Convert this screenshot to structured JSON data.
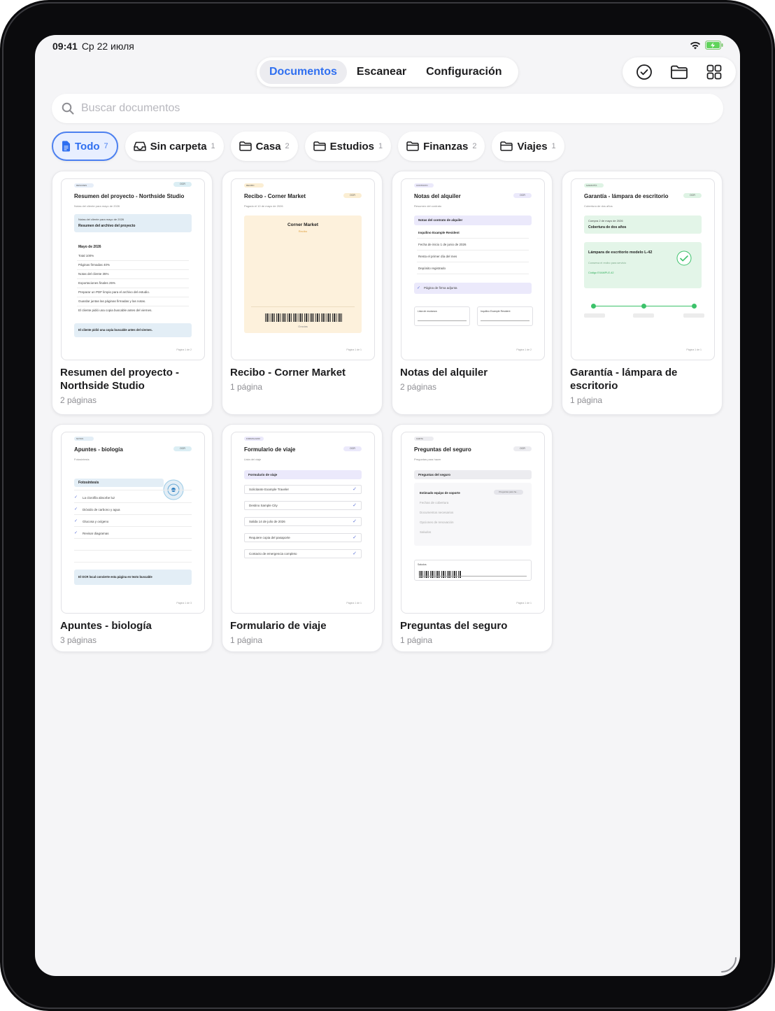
{
  "status_bar": {
    "time": "09:41",
    "date": "Ср 22 июля"
  },
  "tabs": [
    {
      "label": "Documentos",
      "active": true
    },
    {
      "label": "Escanear",
      "active": false
    },
    {
      "label": "Configuración",
      "active": false
    }
  ],
  "toolbar_icons": [
    "checkmark-circle-icon",
    "folder-icon",
    "grid-icon"
  ],
  "search": {
    "placeholder": "Buscar documentos",
    "value": ""
  },
  "filters": [
    {
      "label": "Todo",
      "count": "7",
      "icon": "document-icon",
      "active": true
    },
    {
      "label": "Sin carpeta",
      "count": "1",
      "icon": "tray-icon"
    },
    {
      "label": "Casa",
      "count": "2",
      "icon": "folder-icon"
    },
    {
      "label": "Estudios",
      "count": "1",
      "icon": "folder-icon"
    },
    {
      "label": "Finanzas",
      "count": "2",
      "icon": "folder-icon"
    },
    {
      "label": "Viajes",
      "count": "1",
      "icon": "folder-icon"
    }
  ],
  "colors": {
    "accent": "#2f6ff0",
    "background": "#f5f5f7"
  },
  "documents": [
    {
      "title": "Resumen del proyecto - Northside Studio",
      "pages": "2 páginas",
      "preview": {
        "tag": "RESUMEN",
        "ocr": "OCR",
        "heading": "Resumen del proyecto - Northside Studio",
        "subtitle": "Notas del cliente para mayo de 2026",
        "box_small": "Notas del cliente para mayo de 2026",
        "box_bold": "Resumen del archivo del proyecto",
        "section": "Mayo de 2026",
        "lines": [
          "Total 100%",
          "Páginas firmadas 40%",
          "Notas del cliente 35%",
          "Exportaciones finales 25%",
          "Preparar un PDF limpio para el archivo del estudio.",
          "Guardar juntas las páginas firmadas y las notas.",
          "El cliente pidió una copia buscable antes del viernes."
        ],
        "callout": "El cliente pidió una copia buscable antes del viernes.",
        "footer": "Página 1 de 2"
      }
    },
    {
      "title": "Recibo - Corner Market",
      "pages": "1 página",
      "preview": {
        "tag": "RECIBO",
        "ocr": "OCR",
        "heading": "Recibo - Corner Market",
        "subtitle": "Pagado el 10 de mayo de 2026",
        "store": "Corner Market",
        "store_sub": "Recibo",
        "thanks": "Gracias",
        "footer": "Página 1 de 1"
      }
    },
    {
      "title": "Notas del alquiler",
      "pages": "2 páginas",
      "preview": {
        "tag": "CONTRATO",
        "ocr": "OCR",
        "heading": "Notas del alquiler",
        "subtitle": "Resumen del contrato",
        "box_bold": "Notas del contrato de alquiler",
        "lines": [
          "Inquilino Example Resident",
          "Fecha de inicio 1 de junio de 2026",
          "Renta el primer día del mes",
          "Depósito registrado"
        ],
        "attached": "Página de firma adjunta",
        "sign1": "Lista de mudanza",
        "sign2": "Inquilino Example Resident",
        "footer": "Página 1 de 2"
      }
    },
    {
      "title": "Garantía - lámpara de escritorio",
      "pages": "1 página",
      "preview": {
        "tag": "GARANTÍA",
        "ocr": "OCR",
        "heading": "Garantía - lámpara de escritorio",
        "subtitle": "Cobertura de dos años",
        "box_small": "Compra 2 de mayo de 2026",
        "box_bold": "Cobertura de dos años",
        "product": "Lámpara de escritorio modelo L-42",
        "product_sub": "Conserva el recibo para servicio",
        "code": "Código EXAMPLE-42",
        "footer": "Página 1 de 1"
      }
    },
    {
      "title": "Apuntes - biología",
      "pages": "3 páginas",
      "preview": {
        "tag": "NOTAS",
        "ocr": "OCR",
        "heading": "Apuntes - biología",
        "subtitle": "Fotosíntesis",
        "box_bold": "Fotosíntesis",
        "items": [
          "La clorofila absorbe luz",
          "Dióxido de carbono y agua",
          "Glucosa y oxígeno",
          "Revisar diagramas"
        ],
        "callout": "El OCR local convierte esta página en texto buscable",
        "footer": "Página 1 de 3"
      }
    },
    {
      "title": "Formulario de viaje",
      "pages": "1 página",
      "preview": {
        "tag": "FORMULARIO",
        "ocr": "OCR",
        "heading": "Formulario de viaje",
        "subtitle": "Lista del viaje",
        "box_bold": "Formulario de viaje",
        "rows": [
          "Solicitante Example Traveler",
          "Destino Sample City",
          "Salida 14 de julio de 2026",
          "Requiere copia del pasaporte",
          "Contacto de emergencia completo"
        ],
        "footer": "Página 1 de 1"
      }
    },
    {
      "title": "Preguntas del seguro",
      "pages": "1 página",
      "preview": {
        "tag": "CARTA",
        "ocr": "OCR",
        "heading": "Preguntas del seguro",
        "subtitle": "Preguntas para hacer",
        "box_bold": "Preguntas del seguro",
        "greeting": "Estimado equipo de soporte",
        "badge": "Preguntas para ha...",
        "lines": [
          "Fechas de cobertura",
          "Documentos necesarios",
          "Opciones de renovación",
          "Saludos"
        ],
        "sign_label": "Saludos",
        "footer": "Página 1 de 1"
      }
    }
  ]
}
